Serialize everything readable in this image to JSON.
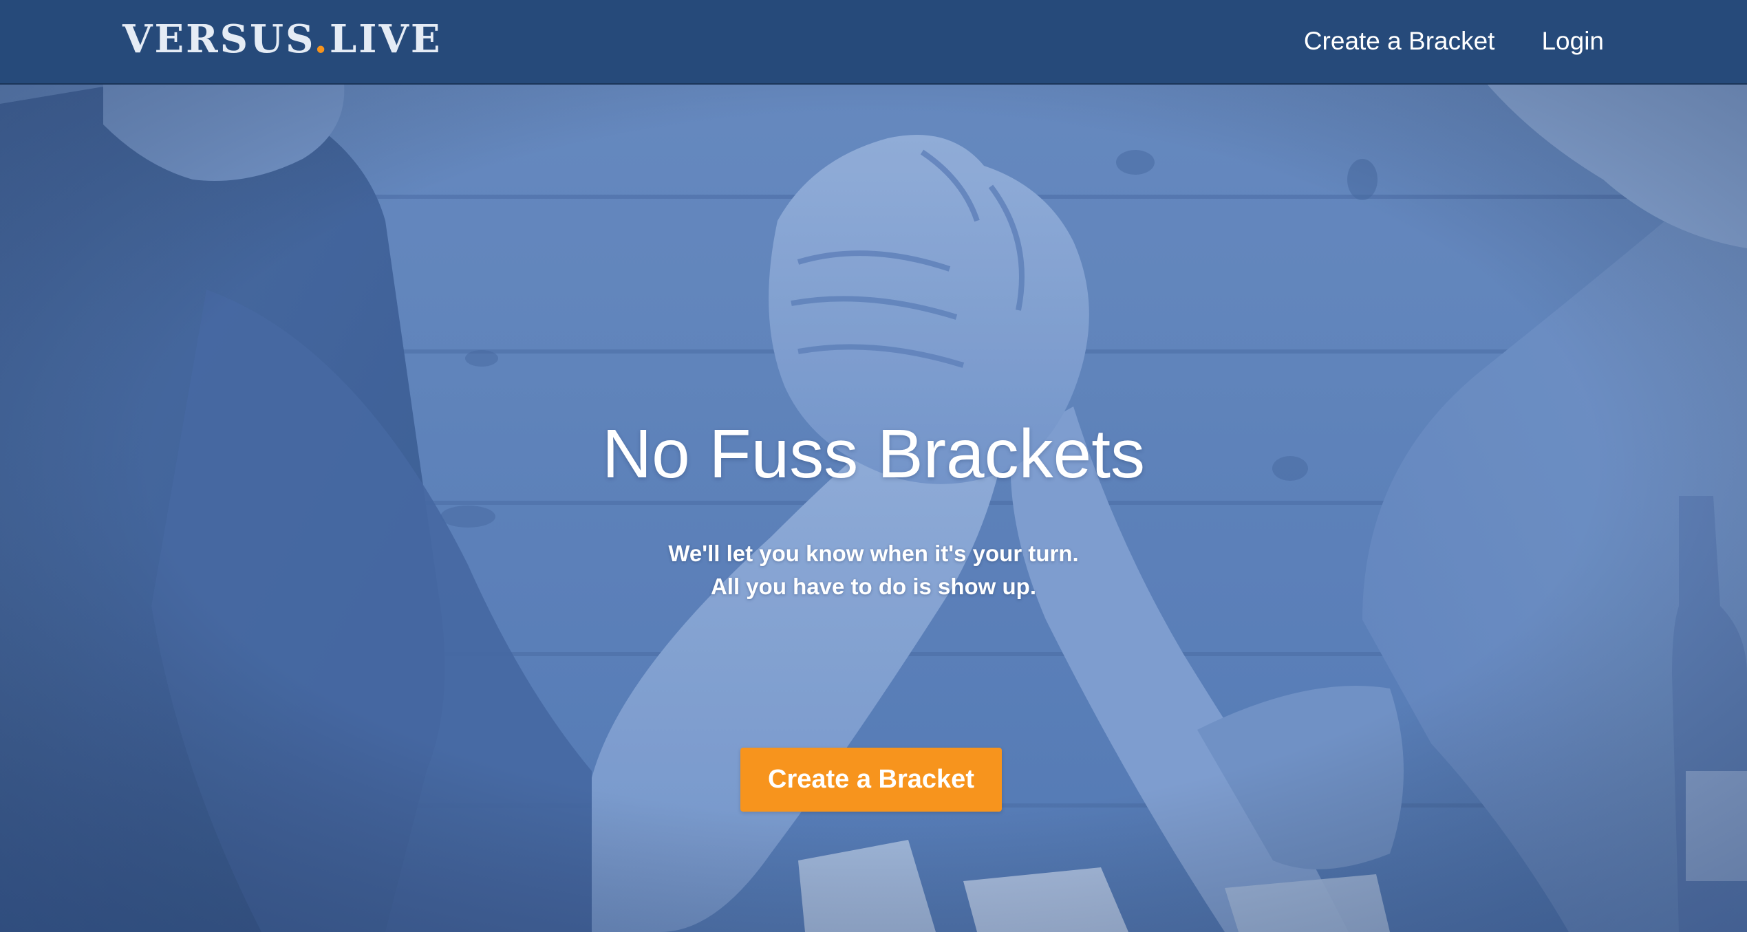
{
  "brand": {
    "logo_main": "VERSUS",
    "logo_dot": ".",
    "logo_suffix": "LIVE"
  },
  "nav": {
    "items": [
      {
        "label": "Create a Bracket"
      },
      {
        "label": "Login"
      }
    ]
  },
  "hero": {
    "title": "No Fuss Brackets",
    "subtitle_line1": "We'll let you know when it's your turn.",
    "subtitle_line2": "All you have to do is show up.",
    "cta_label": "Create a Bracket",
    "background_image": "arm-wrestling-photo"
  },
  "colors": {
    "header_bg": "#264a7a",
    "hero_tint": "#4f74aa",
    "accent": "#f7941d",
    "text": "#ffffff"
  }
}
